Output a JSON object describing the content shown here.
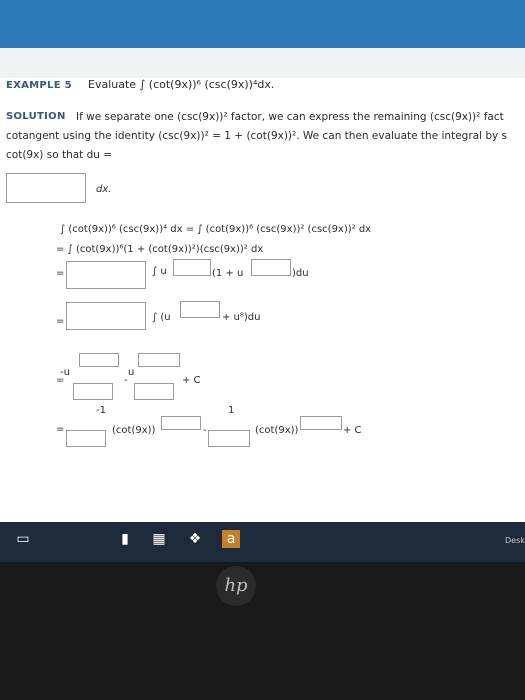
{
  "example": {
    "label": "EXAMPLE 5",
    "prompt": "Evaluate ∫ (cot(9x))⁶ (csc(9x))⁴dx."
  },
  "solution": {
    "label": "SOLUTION",
    "line1": "If we separate one (csc(9x))² factor, we can express the remaining (csc(9x))² fact",
    "line2": "cotangent using the identity (csc(9x))² = 1 + (cot(9x))². We can then evaluate the integral by s",
    "line3": "cot(9x) so that du =",
    "dx": "dx."
  },
  "work": {
    "row1": "∫ (cot(9x))⁶ (csc(9x))⁴ dx = ∫ (cot(9x))⁶ (csc(9x))² (csc(9x))² dx",
    "row2": "= ∫ (cot(9x))⁶(1 + (cot(9x))²)(csc(9x))² dx",
    "eq": "=",
    "int_u": "∫ u",
    "one_plus_u": "(1 + u",
    "close_du": ")du",
    "int_paren_u": "∫ (u",
    "plus_u_du": "+ u⁸)du",
    "neg_u": "-u",
    "u": "u",
    "minus": "-",
    "plus_c": "+ C",
    "neg1": "-1",
    "one": "1",
    "cot9x": "(cot(9x))",
    "minus2": "-"
  },
  "taskbar": {
    "desktop": "Desk",
    "hp": "hp"
  }
}
